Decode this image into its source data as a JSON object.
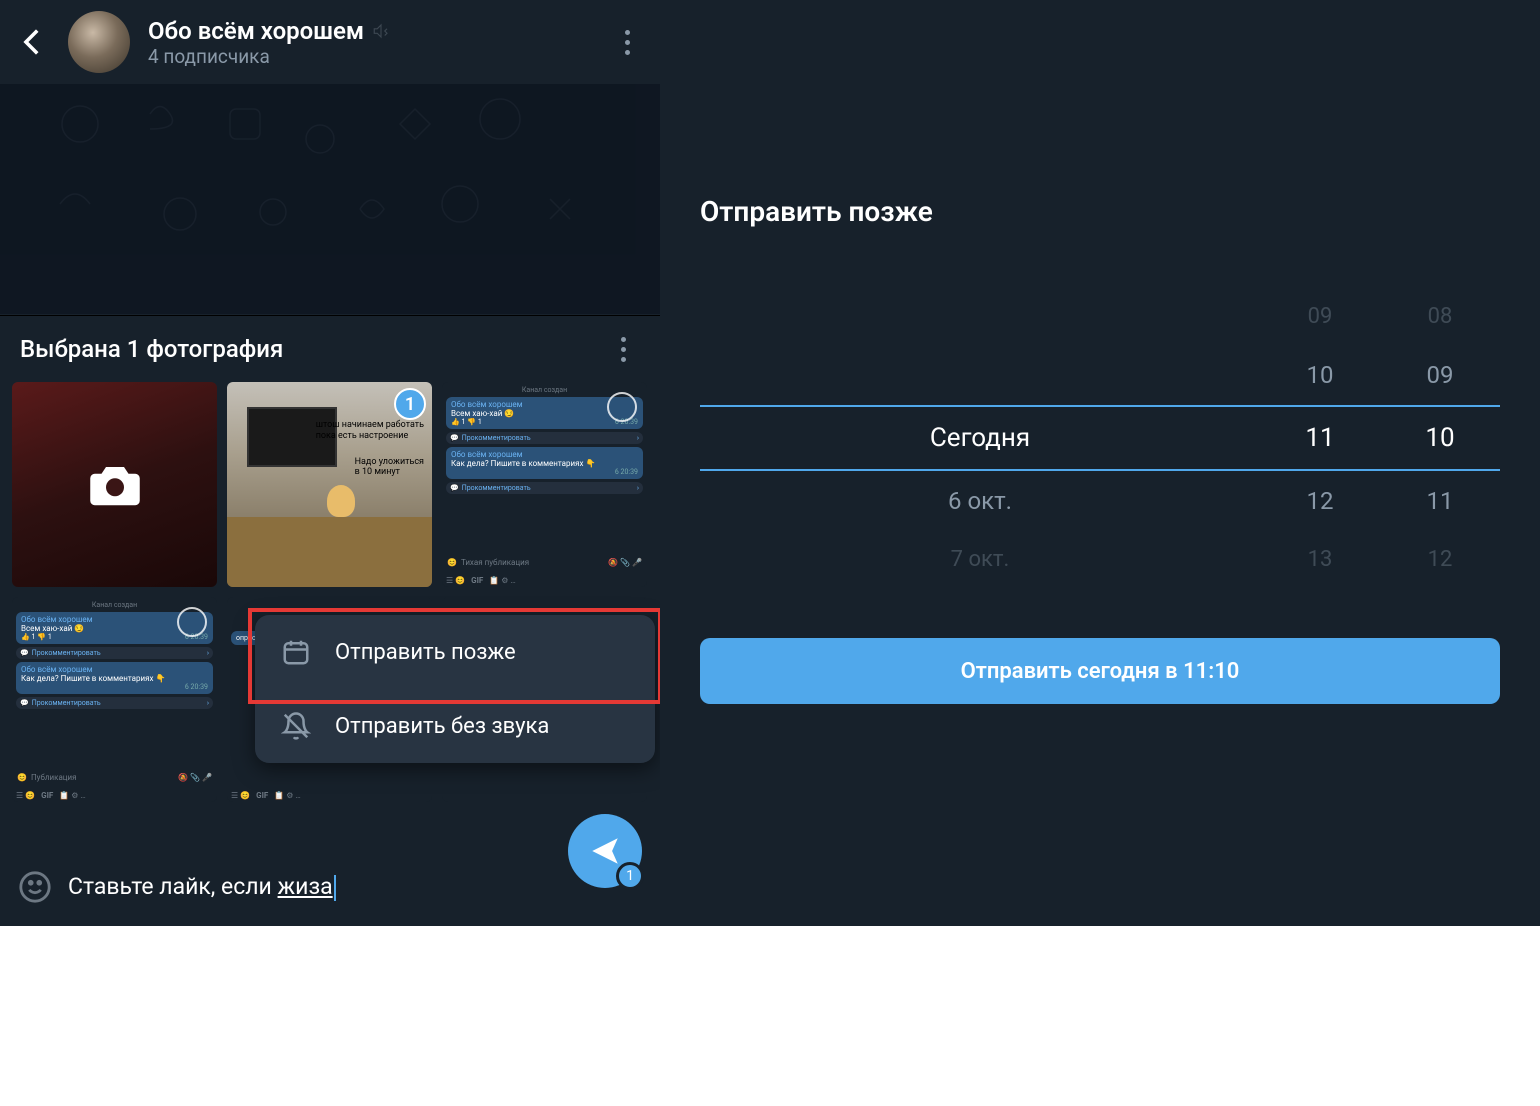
{
  "header": {
    "title": "Обо всём хорошем",
    "subtitle": "4 подписчика"
  },
  "sheet": {
    "title": "Выбрана 1 фотография",
    "selected_badge": "1",
    "thumb2": {
      "line1": "штош начинаем работать",
      "line2": "пока есть настроение",
      "line3": "Надо уложиться",
      "line4": "в 10 минут"
    },
    "thumb_chat": {
      "created": "Канал создан",
      "channel": "Обо всём хорошем",
      "msg1": "Всем хаю-хай 😏",
      "msg2": "Как дела? Пишите в комментариях 👇",
      "comment": "Прокомментировать",
      "quiet": "Тихая публикация",
      "pub": "Публикация",
      "time1": "6  20:39",
      "time2": "6  20:39",
      "react1": "👍 1",
      "react2": "👎 1"
    }
  },
  "menu": {
    "later": "Отправить позже",
    "silent": "Отправить без звука"
  },
  "composer": {
    "text_prefix": "Ставьте лайк, если ",
    "text_underline": "жиза",
    "badge": "1"
  },
  "dialog": {
    "title": "Отправить позже",
    "cols": {
      "date": [
        "",
        "",
        "Сегодня",
        "6 окт.",
        "7 окт."
      ],
      "hour": [
        "09",
        "10",
        "11",
        "12",
        "13"
      ],
      "minute": [
        "08",
        "09",
        "10",
        "11",
        "12"
      ]
    },
    "confirm": "Отправить сегодня в 11:10"
  }
}
